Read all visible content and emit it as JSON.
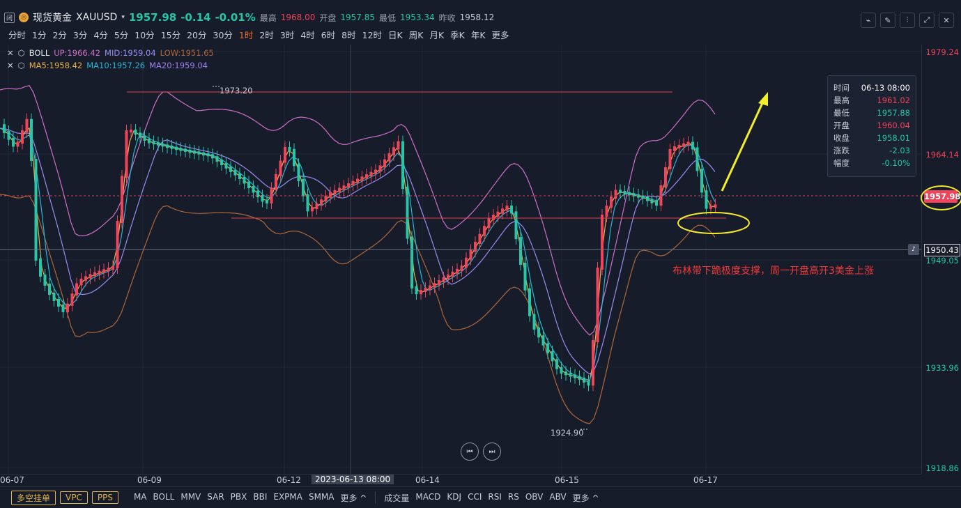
{
  "header": {
    "prefix_icon": "闭",
    "name": "现货黄金",
    "code": "XAUUSD",
    "price": "1957.98",
    "change": "-0.14",
    "change_pct": "-0.01%",
    "high_label": "最高",
    "high": "1968.00",
    "open_label": "开盘",
    "open": "1957.85",
    "low_label": "最低",
    "low": "1953.34",
    "prev_label": "昨收",
    "prev": "1958.12"
  },
  "timeframes": [
    "分时",
    "1分",
    "2分",
    "3分",
    "4分",
    "5分",
    "10分",
    "15分",
    "20分",
    "30分",
    "1时",
    "2时",
    "3时",
    "4时",
    "6时",
    "8时",
    "12时",
    "日K",
    "周K",
    "月K",
    "季K",
    "年K",
    "更多"
  ],
  "active_timeframe": "1时",
  "indicators": {
    "boll": {
      "name": "BOLL",
      "up": "UP:1966.42",
      "mid": "MID:1959.04",
      "low": "LOW:1951.65"
    },
    "ma": {
      "ma5": "MA5:1958.42",
      "ma10": "MA10:1957.26",
      "ma20": "MA20:1959.04"
    }
  },
  "y_axis": [
    "1979.24",
    "1964.14",
    "1949.05",
    "1933.96",
    "1918.86"
  ],
  "price_badge": "1957.98",
  "cursor_price": "1950.43",
  "x_axis": [
    "06-07",
    "06-09",
    "06-12",
    "06-14",
    "06-15",
    "06-17"
  ],
  "cursor_time": "2023-06-13 08:00",
  "annotations": {
    "high_mark": "1973.20",
    "low_mark": "1924.90",
    "comment": "布林带下跪极度支撑，周一开盘高开3美金上涨"
  },
  "tooltip": [
    {
      "k": "时间",
      "v": "06-13 08:00"
    },
    {
      "k": "最高",
      "v": "1961.02"
    },
    {
      "k": "最低",
      "v": "1957.88"
    },
    {
      "k": "开盘",
      "v": "1960.04"
    },
    {
      "k": "收盘",
      "v": "1958.01"
    },
    {
      "k": "涨跌",
      "v": "-2.03"
    },
    {
      "k": "幅度",
      "v": "-0.10%"
    }
  ],
  "bottom_buttons": [
    "多空挂单",
    "VPC",
    "PPS"
  ],
  "bottom_indicators_main": [
    "MA",
    "BOLL",
    "MMV",
    "SAR",
    "PBX",
    "BBI",
    "EXPMA",
    "SMMA",
    "更多 ^"
  ],
  "bottom_indicators_sub": [
    "成交量",
    "MACD",
    "KDJ",
    "CCI",
    "RSI",
    "RS",
    "OBV",
    "ABV",
    "更多 ^"
  ],
  "colors": {
    "up": "#f0445a",
    "down": "#26c6a6",
    "boll_up": "#d070c8",
    "boll_mid": "#9a8cf0",
    "boll_low": "#b0683a",
    "ma5": "#e8b04a",
    "ma10": "#2ab6d6",
    "ma20": "#a080f0"
  }
}
